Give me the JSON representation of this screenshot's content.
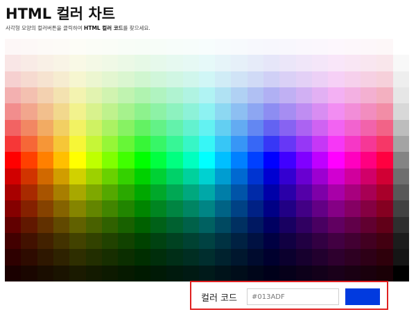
{
  "header": {
    "title": "HTML 컬러 차트",
    "instruction_prefix": "사각형 모양의 컬러버튼을 클릭하여 ",
    "instruction_emphasis": "HTML 컬러 코드",
    "instruction_suffix": "를 찾으세요."
  },
  "color_picker": {
    "label": "컬러 코드",
    "value": "#013ADF",
    "swatch_color": "#013ADF"
  },
  "chart_grid": {
    "columns": 25,
    "rows": 15,
    "gray_column": [
      "#ffffff",
      "#f8f8f8",
      "#eeeeee",
      "#e6e6e6",
      "#d8d8d8",
      "#bdbdbd",
      "#a4a4a4",
      "#848484",
      "#6e6e6e",
      "#585858",
      "#424242",
      "#2e2e2e",
      "#1c1c1c",
      "#151515",
      "#000000"
    ]
  }
}
